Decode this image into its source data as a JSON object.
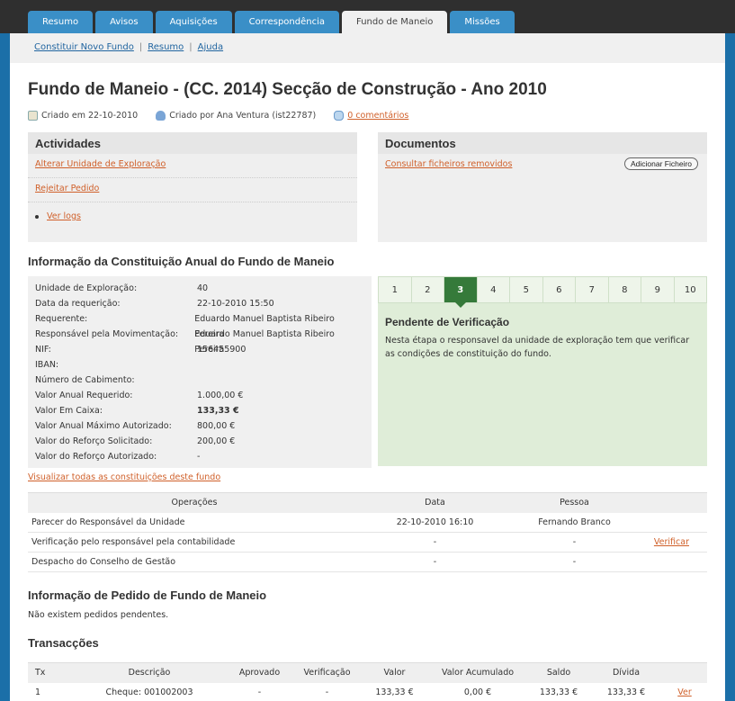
{
  "tabs": [
    "Resumo",
    "Avisos",
    "Aquisições",
    "Correspondência",
    "Fundo de Maneio",
    "Missões"
  ],
  "active_tab": "Fundo de Maneio",
  "subnav": {
    "new_fund": "Constituir Novo Fundo",
    "summary": "Resumo",
    "help": "Ajuda"
  },
  "title": "Fundo de Maneio - (CC. 2014) Secção de Construção - Ano 2010",
  "meta": {
    "created_on": "Criado em 22-10-2010",
    "created_by": "Criado por Ana Ventura (ist22787)",
    "comments": "0 comentários"
  },
  "activities": {
    "heading": "Actividades",
    "items": [
      "Alterar Unidade de Exploração",
      "Rejeitar Pedido"
    ],
    "logs": "Ver logs"
  },
  "documents": {
    "heading": "Documentos",
    "removed": "Consultar ficheiros removidos",
    "add_button": "Adicionar Ficheiro"
  },
  "info": {
    "heading": "Informação da Constituição Anual do Fundo de Maneio",
    "rows": [
      {
        "k": "Unidade de Exploração:",
        "v": "40"
      },
      {
        "k": "Data da requerição:",
        "v": "22-10-2010 15:50"
      },
      {
        "k": "Requerente:",
        "v": "Eduardo Manuel Baptista Ribeiro Pereira"
      },
      {
        "k": "Responsável pela Movimentação:",
        "v": "Eduardo Manuel Baptista Ribeiro Pereira"
      },
      {
        "k": "NIF:",
        "v": "156455900"
      },
      {
        "k": "IBAN:",
        "v": ""
      },
      {
        "k": "Número de Cabimento:",
        "v": ""
      },
      {
        "k": "Valor Anual Requerido:",
        "v": "1.000,00 €"
      },
      {
        "k": "Valor Em Caixa:",
        "v": "133,33 €"
      },
      {
        "k": "Valor Anual Máximo Autorizado:",
        "v": "800,00 €"
      },
      {
        "k": "Valor do Reforço Solicitado:",
        "v": "200,00 €"
      },
      {
        "k": "Valor do Reforço Autorizado:",
        "v": "-"
      }
    ],
    "view_all": "Visualizar todas as constituições deste fundo"
  },
  "state": {
    "steps": [
      "1",
      "2",
      "3",
      "4",
      "5",
      "6",
      "7",
      "8",
      "9",
      "10"
    ],
    "active_step": "3",
    "title": "Pendente de Verificação",
    "description": "Nesta étapa o responsavel da unidade de exploração tem que verificar as condições de constituição do fundo."
  },
  "operations": {
    "headers": [
      "Operações",
      "Data",
      "Pessoa"
    ],
    "rows": [
      {
        "op": "Parecer do Responsável da Unidade",
        "date": "22-10-2010 16:10",
        "person": "Fernando Branco",
        "action": ""
      },
      {
        "op": "Verificação pelo responsável pela contabilidade",
        "date": "-",
        "person": "-",
        "action": "Verificar"
      },
      {
        "op": "Despacho do Conselho de Gestão",
        "date": "-",
        "person": "-",
        "action": ""
      }
    ]
  },
  "request": {
    "heading": "Informação de Pedido de Fundo de Maneio",
    "text": "Não existem pedidos pendentes."
  },
  "transactions": {
    "heading": "Transacções",
    "headers": [
      "Tx",
      "Descrição",
      "Aprovado",
      "Verificação",
      "Valor",
      "Valor Acumulado",
      "Saldo",
      "Dívida"
    ],
    "rows": [
      {
        "tx": "1",
        "desc": "Cheque: 001002003",
        "approved": "-",
        "verification": "-",
        "value": "133,33 €",
        "acc": "0,00 €",
        "balance": "133,33 €",
        "debt": "133,33 €",
        "action": "Ver"
      }
    ]
  },
  "colors": {
    "accent": "#1b6fa8",
    "tab": "#3a8fc7",
    "link": "#d0602a",
    "step_active": "#357a3a"
  }
}
